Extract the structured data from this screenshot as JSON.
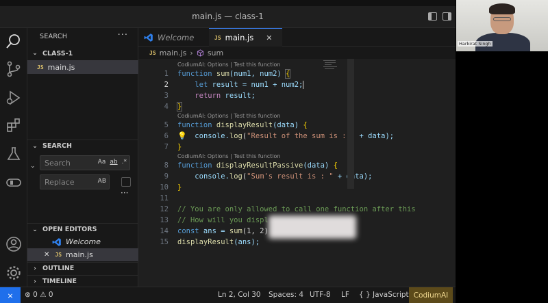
{
  "window": {
    "title": "main.js — class-1"
  },
  "sidebar": {
    "title": "SEARCH",
    "more": "···",
    "folder": "CLASS-1",
    "file": "main.js",
    "file_badge": "JS",
    "search_section": "SEARCH",
    "search_placeholder": "Search",
    "search_opts": [
      "Aa",
      "ab",
      ".*"
    ],
    "replace_placeholder": "Replace",
    "replace_opt": "AB",
    "open_editors_title": "OPEN EDITORS",
    "open_editors": [
      {
        "label": "Welcome",
        "icon": "vscode-icon"
      },
      {
        "label": "main.js",
        "badge": "JS",
        "close": "✕"
      }
    ],
    "outline": "OUTLINE",
    "timeline": "TIMELINE"
  },
  "tabs": [
    {
      "label": "Welcome",
      "icon": "vscode-icon",
      "active": false
    },
    {
      "label": "main.js",
      "badge": "JS",
      "active": true,
      "close": "✕"
    }
  ],
  "breadcrumb": {
    "file": "main.js",
    "badge": "JS",
    "symbol": "sum"
  },
  "editor": {
    "lens": "CodiumAI: Options | Test this function",
    "line_numbers": [
      "1",
      "2",
      "3",
      "4",
      "5",
      "6",
      "7",
      "8",
      "9",
      "10",
      "11",
      "12",
      "13",
      "14",
      "15"
    ],
    "lines": {
      "l1": {
        "kw": "function",
        "fn": "sum",
        "p": "(num1, num2) ",
        "br": "{"
      },
      "l2": {
        "kw": "let",
        "rest": " result = num1 + num2;"
      },
      "l3": {
        "kw": "return",
        "rest": " result;"
      },
      "l4": {
        "br": "}"
      },
      "l5": {
        "kw": "function",
        "fn": "displayResult",
        "p": "(data) ",
        "br": "{"
      },
      "l6": {
        "a": "console.",
        "fn": "log",
        "b": "(",
        "str": "\"Result of the sum is : \"",
        "c": " + data);"
      },
      "l7": {
        "br": "}"
      },
      "l8": {
        "kw": "function",
        "fn": "displayResultPassive",
        "p": "(data) ",
        "br": "{"
      },
      "l9": {
        "a": "console.",
        "fn": "log",
        "b": "(",
        "str": "\"Sum's result is : \"",
        "c": " + data);"
      },
      "l10": {
        "br": "}"
      },
      "l12": {
        "cm": "// You are only allowed to call one function after this"
      },
      "l13": {
        "cm": "// How will you displ"
      },
      "l14": {
        "kw": "const",
        "a": " ans = ",
        "fn": "sum",
        "b": "(1, 2)"
      },
      "l15": {
        "fn": "displayResult",
        "b": "(ans);"
      }
    }
  },
  "status": {
    "remote": "⨯",
    "problems": "⊗ 0 ⚠ 0",
    "position": "Ln 2, Col 30",
    "spaces": "Spaces: 4",
    "encoding": "UTF-8",
    "eol": "LF",
    "language": "{ } JavaScript",
    "codium": "CodiumAI"
  },
  "webcam": {
    "name": "Harkirat Singh"
  },
  "colors": {
    "accent": "#1f6feb",
    "keyword": "#569cd6",
    "function": "#dcdcaa",
    "string": "#ce9178",
    "comment": "#6a9955"
  }
}
